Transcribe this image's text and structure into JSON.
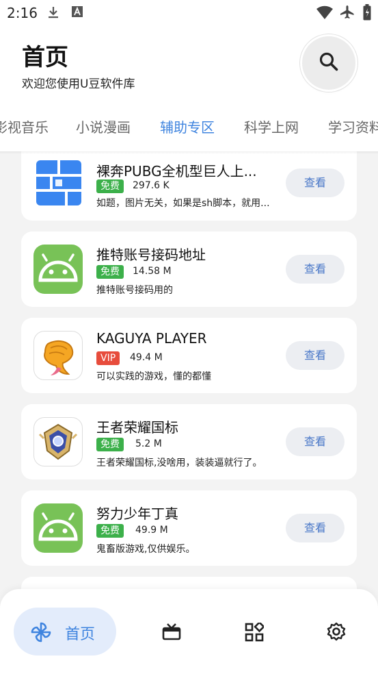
{
  "status_bar": {
    "time": "2:16",
    "left_icons": [
      "download-icon",
      "text-a-icon"
    ],
    "right_icons": [
      "wifi-icon",
      "airplane-icon",
      "battery-icon"
    ]
  },
  "header": {
    "title": "首页",
    "subtitle": "欢迎您使用U豆软件库"
  },
  "tabs": [
    {
      "label": "影视音乐",
      "active": false
    },
    {
      "label": "小说漫画",
      "active": false
    },
    {
      "label": "辅助专区",
      "active": true
    },
    {
      "label": "科学上网",
      "active": false
    },
    {
      "label": "学习资料",
      "active": false
    }
  ],
  "apps": [
    {
      "name": "裸奔PUBG全机型巨人上...",
      "badge": "免费",
      "badge_type": "free",
      "size": "297.6 K",
      "desc": "如题，图片无关，如果是sh脚本，就用...",
      "button": "查看",
      "icon": "blue-blocks-icon"
    },
    {
      "name": "推特账号接码地址",
      "badge": "免费",
      "badge_type": "free",
      "size": "14.58 M",
      "desc": "推特账号接码用的",
      "button": "查看",
      "icon": "android-icon"
    },
    {
      "name": "KAGUYA PLAYER",
      "badge": "VIP",
      "badge_type": "vip",
      "size": "49.4 M",
      "desc": "可以实践的游戏，懂的都懂",
      "button": "查看",
      "icon": "shrimp-icon"
    },
    {
      "name": "王者荣耀国标",
      "badge": "免费",
      "badge_type": "free",
      "size": "5.2 M",
      "desc": "王者荣耀国标,没啥用，装装逼就行了。",
      "button": "查看",
      "icon": "honor-emblem-icon"
    },
    {
      "name": "努力少年丁真",
      "badge": "免费",
      "badge_type": "free",
      "size": "49.9 M",
      "desc": "鬼畜版游戏,仅供娱乐。",
      "button": "查看",
      "icon": "android-icon"
    }
  ],
  "bottom_nav": {
    "home_label": "首页",
    "items": [
      "pinwheel-icon",
      "gift-box-icon",
      "apps-grid-icon",
      "gear-icon"
    ]
  },
  "colors": {
    "accent": "#3f84df",
    "free_badge": "#3cb04a",
    "vip_badge": "#e74c3c",
    "android_green": "#78c257"
  }
}
